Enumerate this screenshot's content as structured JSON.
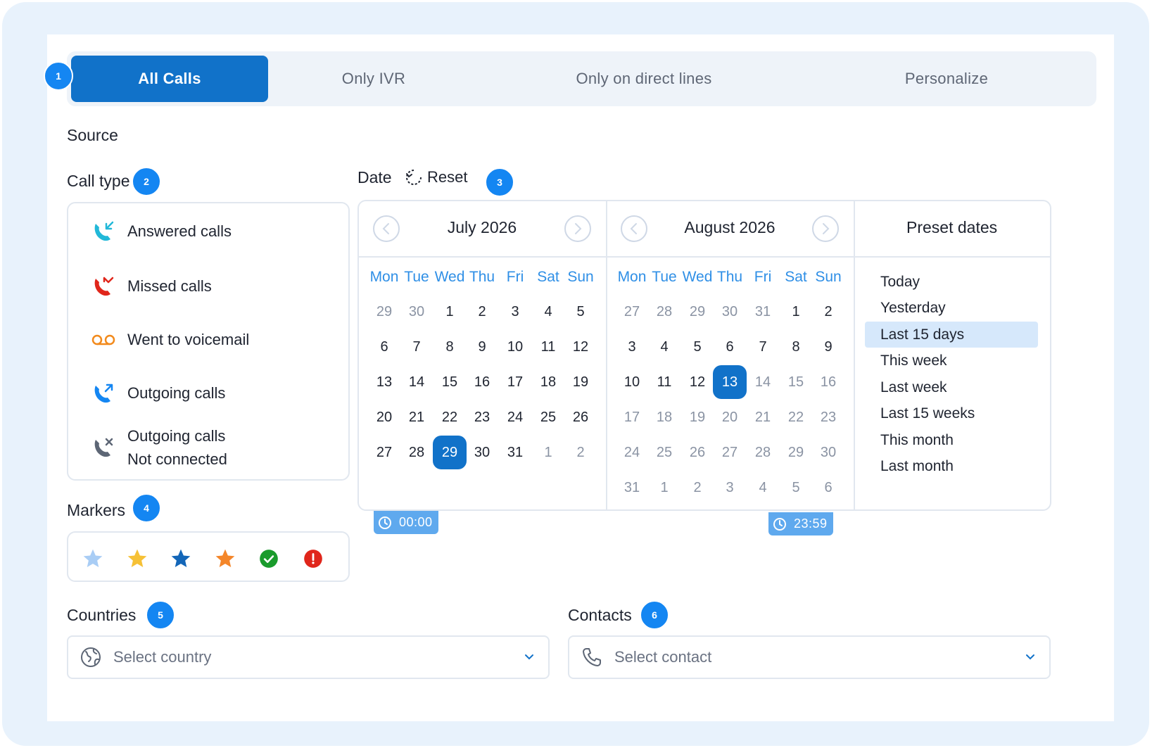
{
  "tabs": [
    {
      "label": "All Calls",
      "active": true
    },
    {
      "label": "Only IVR",
      "active": false
    },
    {
      "label": "Only on direct lines",
      "active": false
    },
    {
      "label": "Personalize",
      "active": false
    }
  ],
  "steps": [
    "1",
    "2",
    "3",
    "4",
    "5",
    "6"
  ],
  "source_heading": "Source",
  "call_type": {
    "heading": "Call type",
    "items": [
      {
        "label": "Answered calls",
        "icon": "answered-call-icon",
        "color": "#22b8d8"
      },
      {
        "label": "Missed calls",
        "icon": "missed-call-icon",
        "color": "#e0261b"
      },
      {
        "label": "Went to voicemail",
        "icon": "voicemail-icon",
        "color": "#f28a1c"
      },
      {
        "label": "Outgoing calls",
        "icon": "outgoing-call-icon",
        "color": "#1486f2"
      },
      {
        "label": "Outgoing calls",
        "label2": "Not connected",
        "icon": "not-connected-call-icon",
        "color": "#5d6675"
      }
    ]
  },
  "date": {
    "heading": "Date",
    "reset_label": "Reset"
  },
  "calendar": {
    "weekdays": [
      "Mon",
      "Tue",
      "Wed",
      "Thu",
      "Fri",
      "Sat",
      "Sun"
    ],
    "months": [
      {
        "title": "July 2026",
        "weeks": [
          [
            {
              "d": "29",
              "m": true
            },
            {
              "d": "30",
              "m": true
            },
            {
              "d": "1"
            },
            {
              "d": "2"
            },
            {
              "d": "3"
            },
            {
              "d": "4"
            },
            {
              "d": "5"
            }
          ],
          [
            {
              "d": "6"
            },
            {
              "d": "7"
            },
            {
              "d": "8"
            },
            {
              "d": "9"
            },
            {
              "d": "10"
            },
            {
              "d": "11"
            },
            {
              "d": "12"
            }
          ],
          [
            {
              "d": "13"
            },
            {
              "d": "14"
            },
            {
              "d": "15"
            },
            {
              "d": "16"
            },
            {
              "d": "17"
            },
            {
              "d": "18"
            },
            {
              "d": "19"
            }
          ],
          [
            {
              "d": "20"
            },
            {
              "d": "21"
            },
            {
              "d": "22"
            },
            {
              "d": "23"
            },
            {
              "d": "24"
            },
            {
              "d": "25"
            },
            {
              "d": "26"
            }
          ],
          [
            {
              "d": "27"
            },
            {
              "d": "28"
            },
            {
              "d": "29",
              "sel": true
            },
            {
              "d": "30"
            },
            {
              "d": "31"
            },
            {
              "d": "1",
              "m": true
            },
            {
              "d": "2",
              "m": true
            }
          ]
        ]
      },
      {
        "title": "August 2026",
        "weeks": [
          [
            {
              "d": "27",
              "m": true
            },
            {
              "d": "28",
              "m": true
            },
            {
              "d": "29",
              "m": true
            },
            {
              "d": "30",
              "m": true
            },
            {
              "d": "31",
              "m": true
            },
            {
              "d": "1"
            },
            {
              "d": "2"
            }
          ],
          [
            {
              "d": "3"
            },
            {
              "d": "4"
            },
            {
              "d": "5"
            },
            {
              "d": "6"
            },
            {
              "d": "7"
            },
            {
              "d": "8"
            },
            {
              "d": "9"
            }
          ],
          [
            {
              "d": "10"
            },
            {
              "d": "11"
            },
            {
              "d": "12"
            },
            {
              "d": "13",
              "sel": true
            },
            {
              "d": "14",
              "m": true
            },
            {
              "d": "15",
              "m": true
            },
            {
              "d": "16",
              "m": true
            }
          ],
          [
            {
              "d": "17",
              "m": true
            },
            {
              "d": "18",
              "m": true
            },
            {
              "d": "19",
              "m": true
            },
            {
              "d": "20",
              "m": true
            },
            {
              "d": "21",
              "m": true
            },
            {
              "d": "22",
              "m": true
            },
            {
              "d": "23",
              "m": true
            }
          ],
          [
            {
              "d": "24",
              "m": true
            },
            {
              "d": "25",
              "m": true
            },
            {
              "d": "26",
              "m": true
            },
            {
              "d": "27",
              "m": true
            },
            {
              "d": "28",
              "m": true
            },
            {
              "d": "29",
              "m": true
            },
            {
              "d": "30",
              "m": true
            }
          ],
          [
            {
              "d": "31",
              "m": true
            },
            {
              "d": "1",
              "m": true
            },
            {
              "d": "2",
              "m": true
            },
            {
              "d": "3",
              "m": true
            },
            {
              "d": "4",
              "m": true
            },
            {
              "d": "5",
              "m": true
            },
            {
              "d": "6",
              "m": true
            }
          ]
        ]
      }
    ],
    "start_time": "00:00",
    "end_time": "23:59"
  },
  "presets": {
    "title": "Preset dates",
    "items": [
      {
        "label": "Today",
        "active": false
      },
      {
        "label": "Yesterday",
        "active": false
      },
      {
        "label": "Last 15 days",
        "active": true
      },
      {
        "label": "This week",
        "active": false
      },
      {
        "label": "Last week",
        "active": false
      },
      {
        "label": "Last 15 weeks",
        "active": false
      },
      {
        "label": "This month",
        "active": false
      },
      {
        "label": "Last month",
        "active": false
      }
    ]
  },
  "markers": {
    "heading": "Markers",
    "items": [
      {
        "icon": "star-light-blue-icon",
        "color": "#a9cdf5"
      },
      {
        "icon": "star-yellow-icon",
        "color": "#f6c136"
      },
      {
        "icon": "star-dark-blue-icon",
        "color": "#1366b8"
      },
      {
        "icon": "star-orange-icon",
        "color": "#f4862a"
      },
      {
        "icon": "check-circle-icon",
        "color": "#1a9b2c"
      },
      {
        "icon": "alert-circle-icon",
        "color": "#e0261b"
      }
    ]
  },
  "countries": {
    "heading": "Countries",
    "placeholder": "Select country"
  },
  "contacts": {
    "heading": "Contacts",
    "placeholder": "Select contact"
  }
}
